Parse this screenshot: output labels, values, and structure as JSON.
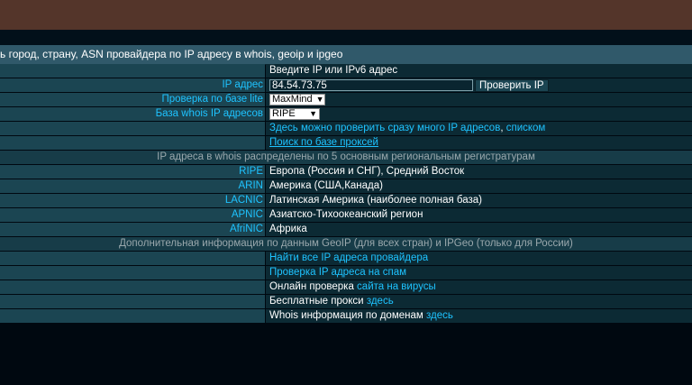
{
  "page": {
    "title": "ь город, страну, ASN провайдера по IP адресу в whois, geoip и ipgeo"
  },
  "form": {
    "prompt": "Введите IP или IPv6 адрес",
    "ip_label": "IP адрес",
    "ip_value": "84.54.73.75",
    "check_button": "Проверить IP",
    "lite_label": "Проверка по базе lite",
    "lite_value": "MaxMind",
    "whois_label": "База whois IP адресов",
    "whois_value": "RIPE"
  },
  "links": {
    "many_here": "Здесь",
    "many_text": "можно проверить сразу",
    "many_link": "много IP адресов",
    "many_sep": ",",
    "many_list": "списком",
    "proxy_search": "Поиск по базе проксей"
  },
  "registries": {
    "heading": "IP адреса в whois распределены по 5 основным региональным регистратурам",
    "items": [
      {
        "name": "RIPE",
        "desc": "Европа (Россия и СНГ), Средний Восток"
      },
      {
        "name": "ARIN",
        "desc": "Америка (США,Канада)"
      },
      {
        "name": "LACNIC",
        "desc": "Латинская Америка (наиболее полная база)"
      },
      {
        "name": "APNIC",
        "desc": "Азиатско-Тихоокеанский регион"
      },
      {
        "name": "AfriNIC",
        "desc": "Африка"
      }
    ]
  },
  "extra": {
    "heading": "Дополнительная информация по данным GeoIP (для всех стран) и IPGeo (только для России)",
    "find_all": "Найти все IP адреса провайдера",
    "spam_check": "Проверка IP адреса на спам",
    "virus_a": "Онлайн проверка",
    "virus_b": "сайта на вирусы",
    "proxy_a": "Бесплатные прокси",
    "proxy_b": "здесь",
    "whois_a": "Whois информация по доменам",
    "whois_b": "здесь"
  },
  "colors": {
    "link": "#1ec3ff",
    "header_bg": "#30596a",
    "left_cell_bg": "#1b4552",
    "right_cell_bg": "#0c2a34",
    "banner_brown": "#54352a"
  }
}
